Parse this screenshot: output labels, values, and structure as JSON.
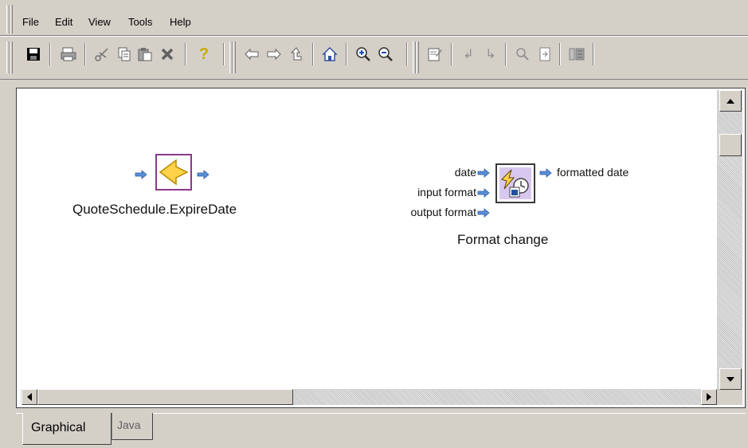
{
  "menu": {
    "items": [
      {
        "label": "File",
        "name": "menu-file"
      },
      {
        "label": "Edit",
        "name": "menu-edit"
      },
      {
        "label": "View",
        "name": "menu-view"
      },
      {
        "label": "Tools",
        "name": "menu-tools"
      },
      {
        "label": "Help",
        "name": "menu-help"
      }
    ]
  },
  "toolbar": {
    "icons": [
      "save-icon",
      "print-icon",
      "cut-icon",
      "copy-icon",
      "paste-icon",
      "delete-icon",
      "help-icon",
      "back-icon",
      "forward-icon",
      "up-icon",
      "home-icon",
      "zoom-in-icon",
      "zoom-out-icon",
      "edit-properties-icon",
      "step-into-icon",
      "step-out-icon",
      "find-icon",
      "find-next-icon",
      "map-icon"
    ]
  },
  "canvas": {
    "source_node": {
      "label": "QuoteSchedule.ExpireDate"
    },
    "function_node": {
      "label": "Format change",
      "inputs": [
        "date",
        "input format",
        "output format"
      ],
      "output": "formatted date"
    }
  },
  "tabs": [
    {
      "label": "Graphical",
      "active": true
    },
    {
      "label": "Java",
      "active": false
    }
  ],
  "colors": {
    "arrow": "#5b8fd6",
    "node_border": "#8b3a8b",
    "diamond": "#ffd24a"
  }
}
